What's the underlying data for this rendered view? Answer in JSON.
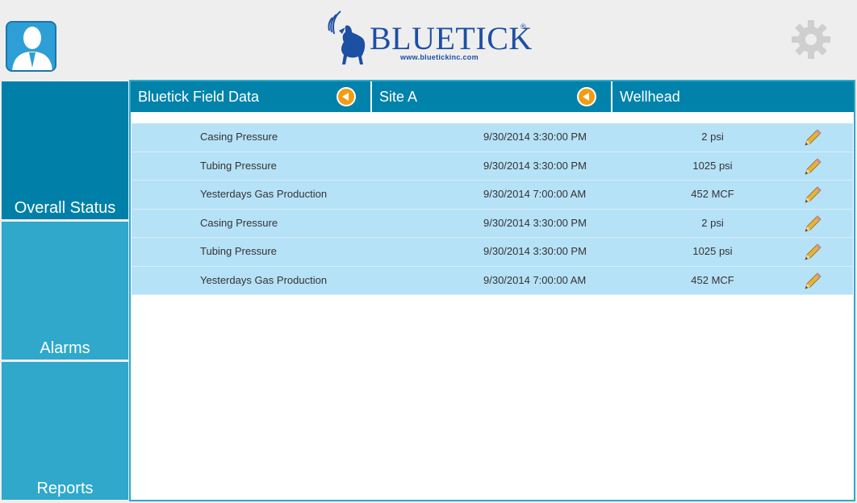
{
  "header": {
    "logo_text": "BLUETICK",
    "logo_reg": "®",
    "logo_url": "www.bluetickinc.com",
    "avatar_icon": "user-icon",
    "settings_icon": "gear-icon"
  },
  "sidebar": {
    "items": [
      {
        "label": "Overall Status",
        "active": true
      },
      {
        "label": "Alarms",
        "active": false
      },
      {
        "label": "Reports",
        "active": false
      }
    ]
  },
  "breadcrumb": {
    "items": [
      {
        "label": "Bluetick Field Data",
        "has_back": true
      },
      {
        "label": "Site A",
        "has_back": true
      },
      {
        "label": "Wellhead",
        "has_back": false
      }
    ]
  },
  "table": {
    "rows": [
      {
        "name": "Casing Pressure",
        "timestamp": "9/30/2014 3:30:00 PM",
        "value": "2 psi"
      },
      {
        "name": "Tubing Pressure",
        "timestamp": "9/30/2014 3:30:00 PM",
        "value": "1025 psi"
      },
      {
        "name": "Yesterdays Gas Production",
        "timestamp": "9/30/2014 7:00:00 AM",
        "value": "452 MCF"
      },
      {
        "name": "Casing Pressure",
        "timestamp": "9/30/2014 3:30:00 PM",
        "value": "2 psi"
      },
      {
        "name": "Tubing Pressure",
        "timestamp": "9/30/2014 3:30:00 PM",
        "value": "1025 psi"
      },
      {
        "name": "Yesterdays Gas Production",
        "timestamp": "9/30/2014 7:00:00 AM",
        "value": "452 MCF"
      }
    ]
  },
  "colors": {
    "accent": "#0082ab",
    "nav_active": "#0080a8",
    "nav_inactive": "#2fa8cc",
    "row_bg": "#b6e2f7",
    "back_button": "#f39c12",
    "logo_blue": "#1d4fa3"
  }
}
